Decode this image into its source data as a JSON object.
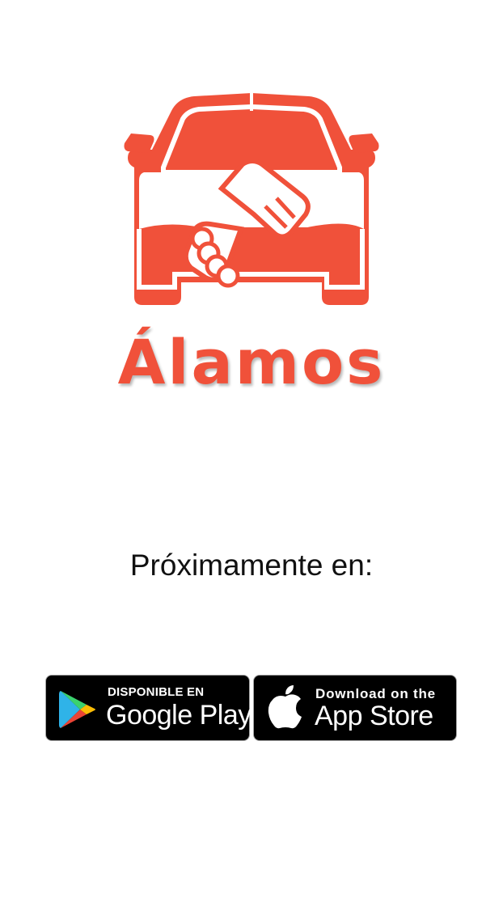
{
  "brand": {
    "name": "Álamos",
    "color": "#f0513a",
    "logo_icon": "car-handshake-logo"
  },
  "coming_soon": {
    "text": "Próximamente en:"
  },
  "badges": {
    "google_play": {
      "small_text": "DISPONIBLE EN",
      "big_text": "Google Play",
      "icon": "google-play-icon"
    },
    "app_store": {
      "small_text": "Download on the",
      "big_text": "App Store",
      "icon": "apple-icon"
    }
  }
}
